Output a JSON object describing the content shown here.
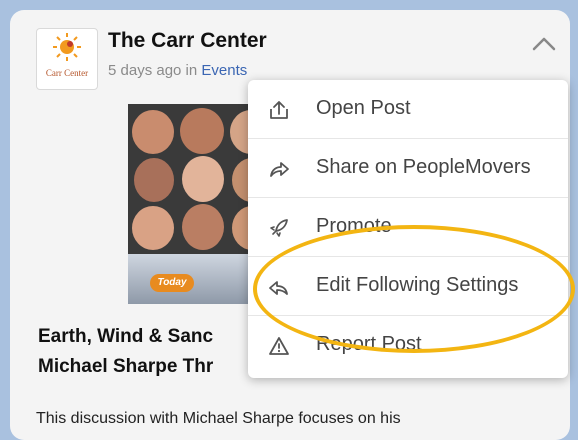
{
  "post": {
    "author": "The Carr Center",
    "avatar_text": "Carr Center",
    "time": "5 days ago in ",
    "category": "Events",
    "thumbnail_caption": "Today",
    "headline_line1": "Earth, Wind & Sanc",
    "headline_line2": "Michael Sharpe Thr",
    "body_preview": "This discussion with Michael Sharpe focuses on his"
  },
  "menu": {
    "items": [
      {
        "label": "Open Post",
        "icon": "open-post-icon"
      },
      {
        "label": "Share on PeopleMovers",
        "icon": "share-icon"
      },
      {
        "label": "Promote",
        "icon": "rocket-icon"
      },
      {
        "label": "Edit Following Settings",
        "icon": "reply-arrow-icon"
      },
      {
        "label": "Report Post",
        "icon": "warning-icon"
      }
    ]
  },
  "colors": {
    "background": "#a9c1df",
    "card": "#f4f4f4",
    "highlight": "#f3b512",
    "link": "#3b66b3"
  }
}
